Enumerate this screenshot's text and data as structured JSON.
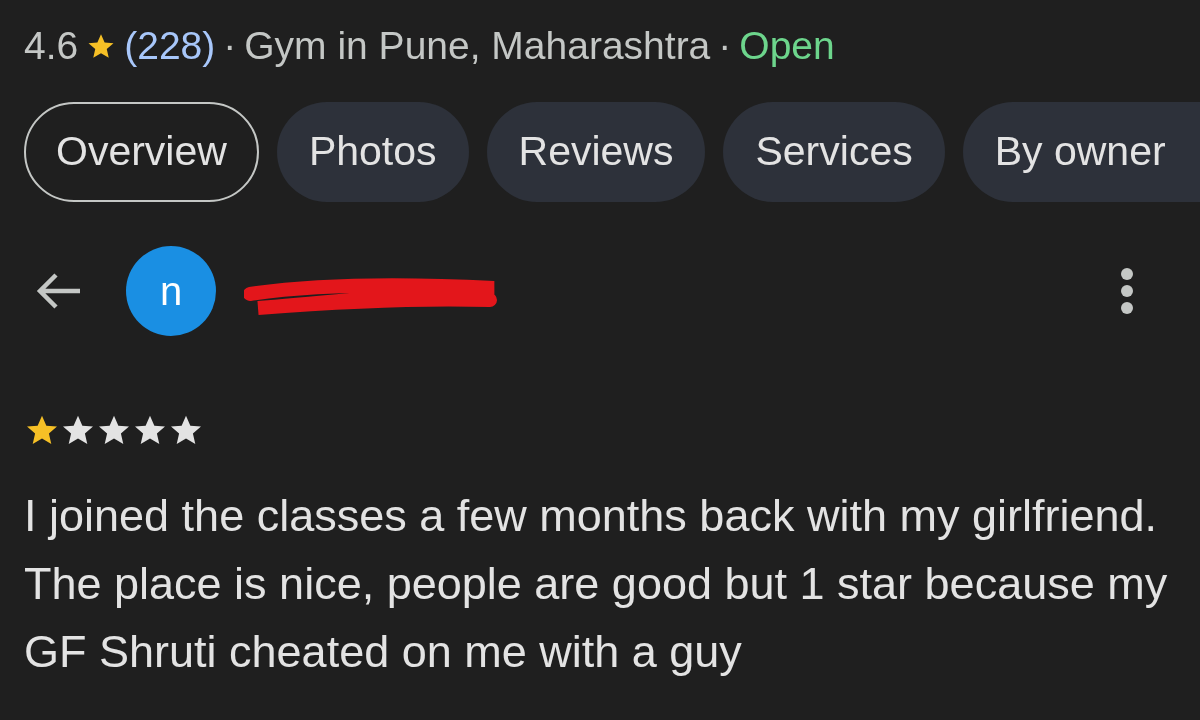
{
  "place": {
    "rating": "4.6",
    "review_count": "(228)",
    "separator_1": "·",
    "category": "Gym in Pune, Maharashtra",
    "separator_2": "·",
    "status": "Open"
  },
  "tabs": [
    {
      "label": "Overview",
      "selected": true
    },
    {
      "label": "Photos",
      "selected": false
    },
    {
      "label": "Reviews",
      "selected": false
    },
    {
      "label": "Services",
      "selected": false
    },
    {
      "label": "By owner",
      "selected": false
    }
  ],
  "review": {
    "avatar_letter": "n",
    "author_redacted": true,
    "stars": 1,
    "text": "I joined the classes a few months back with my girlfriend. The place is nice, people are good but 1 star because my GF Shruti cheated on me with a guy"
  }
}
